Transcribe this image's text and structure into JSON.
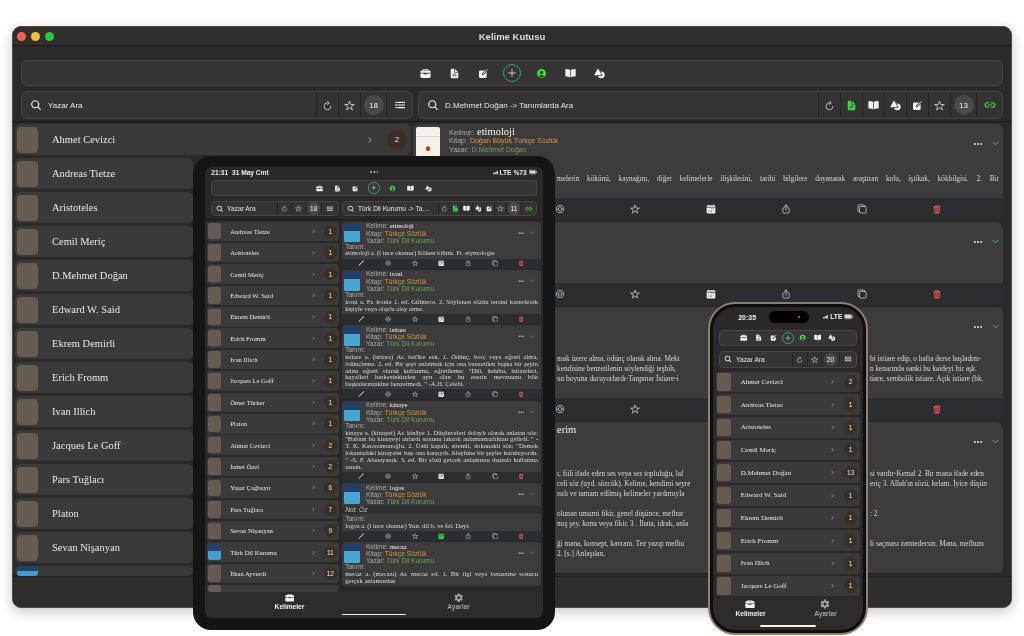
{
  "window": {
    "title": "Kelime Kutusu",
    "toolbar": [
      {
        "kind": "briefcase",
        "selected": false
      },
      {
        "kind": "document",
        "selected": false
      },
      {
        "kind": "edit",
        "selected": false
      },
      {
        "kind": "add",
        "selected": false
      },
      {
        "kind": "person",
        "selected": true
      },
      {
        "kind": "book",
        "selected": false
      },
      {
        "kind": "shapes",
        "selected": false
      }
    ],
    "author_search": {
      "placeholder": "Yazar Ara",
      "tools": [
        {
          "kind": "refresh",
          "on": false
        },
        {
          "kind": "star",
          "on": false
        }
      ],
      "count": "18",
      "trailing": [
        {
          "kind": "list",
          "on": false
        }
      ]
    },
    "word_search": {
      "placeholder": "D.Mehmet Doğan -> Tanımlarda Ara",
      "tools": [
        {
          "kind": "refresh",
          "on": false
        },
        {
          "kind": "document",
          "on": true
        },
        {
          "kind": "book",
          "on": false
        },
        {
          "kind": "shapes",
          "on": false
        },
        {
          "kind": "edit",
          "on": false
        },
        {
          "kind": "star",
          "on": false
        }
      ],
      "count": "13",
      "trailing": [
        {
          "kind": "link",
          "on": true
        }
      ]
    },
    "authors": [
      {
        "kind": "person",
        "name": "Ahmet Cevizci",
        "count": "2"
      },
      {
        "kind": "person",
        "name": "Andreas Tietze"
      },
      {
        "kind": "person",
        "name": "Aristoteles"
      },
      {
        "kind": "person",
        "name": "Cemil Meriç"
      },
      {
        "kind": "person",
        "name": "D.Mehmet Doğan"
      },
      {
        "kind": "person",
        "name": "Edward W. Said"
      },
      {
        "kind": "person",
        "name": "Ekrem Demirli"
      },
      {
        "kind": "person",
        "name": "Erich Fromm"
      },
      {
        "kind": "person",
        "name": "Ivan Illich"
      },
      {
        "kind": "person",
        "name": "Jacques Le Goff"
      },
      {
        "kind": "person",
        "name": "Pars Tuğlacı"
      },
      {
        "kind": "person",
        "name": "Platon"
      },
      {
        "kind": "person",
        "name": "Sevan Nişanyan"
      },
      {
        "kind": "book"
      }
    ],
    "words": [
      {
        "word_label": "Kelime:",
        "word": "etimoloji",
        "book_label": "Kitap:",
        "book": "Doğan Büyük Türkçe Sözlük",
        "author_label": "Yazar:",
        "author": "D.Mehmet Doğan",
        "paragraphs": [
          [
            {
              "start": "melerin kökünü, kaynağını, diğer kelimelerle ilişkilerini, tarihi bilgilere dayanarak araştıran kolu, iştikak, kökbilgisi. 2. Bir"
            }
          ]
        ],
        "reminder": false
      },
      {
        "reminder": false
      },
      {
        "paragraphs": [
          [
            {
              "start": "mak üzere alma, ödünç olarak alma. Mekt",
              "end": "bi istiare edip, o hafta derse başladım-"
            },
            {
              "start": "kendisine benzetilenin söylendiği teşbih,",
              "end": "n kenarında sanki bu kaideyi bir aşk"
            },
            {
              "start": "un boyuna duruyorlardı-Tanpınar İstiare-i",
              "end": "tiare, sembolik istiare. Açık istiare (bk."
            }
          ]
        ]
      },
      {
        "word": "erim",
        "paragraphs": [
          [
            {
              "start": "ı, fiili ifade eden ses veya ses topluluğu, laf",
              "end": "si vardır-Kemal 2. Bir mana ifade eden"
            },
            {
              "start": "celi söz (uyd. sözcük). Kelime, kendimi seyre",
              "end": "eriç 3. Allah'ın sözü, kelam. İyice düşün"
            },
            {
              "start": "ısılı ve tamam edilmiş kelimeler yardımıyla"
            }
          ],
          [
            {
              "start": "olunan umumi fikir, genel düşünce, mefhur",
              "end": ": 2."
            },
            {
              "start": "mış şey, konu veya fikir. 3 . İhata, idrak, anla"
            }
          ],
          [
            {
              "start": "ği mana, konsept, kavram. Tez yazıp mefhu",
              "end": "li saçması zannedersin. Mana, mefhum"
            },
            {
              "start": "2. [s.] Anlaşılan,"
            }
          ]
        ]
      }
    ]
  },
  "tablet": {
    "status": {
      "time": "21:31",
      "date": "31 May Cmt",
      "network": "LTE",
      "battery": "%73"
    },
    "toolbar": [
      {
        "kind": "briefcase",
        "selected": false
      },
      {
        "kind": "document",
        "selected": false
      },
      {
        "kind": "edit",
        "selected": false
      },
      {
        "kind": "add",
        "selected": false
      },
      {
        "kind": "person",
        "selected": true
      },
      {
        "kind": "book",
        "selected": false
      },
      {
        "kind": "shapes",
        "selected": false
      }
    ],
    "author_search": {
      "placeholder": "Yazar Ara",
      "tools": [
        {
          "kind": "refresh",
          "on": false
        },
        {
          "kind": "star",
          "on": false
        }
      ],
      "count": "18",
      "trailing": [
        {
          "kind": "list",
          "on": false
        }
      ]
    },
    "word_search": {
      "placeholder": "Türk Dil Kurumu -> Ta…",
      "tools": [
        {
          "kind": "refresh",
          "on": false
        },
        {
          "kind": "document",
          "on": true
        },
        {
          "kind": "book",
          "on": false
        },
        {
          "kind": "shapes",
          "on": false
        },
        {
          "kind": "edit",
          "on": false
        },
        {
          "kind": "star",
          "on": false
        }
      ],
      "count": "11",
      "trailing": [
        {
          "kind": "link",
          "on": true
        }
      ]
    },
    "authors": [
      {
        "kind": "person",
        "name": "Andreas Tietze",
        "count": "1"
      },
      {
        "kind": "person",
        "name": "Aristoteles",
        "count": "1"
      },
      {
        "kind": "person",
        "name": "Cemil Meriç",
        "count": "1"
      },
      {
        "kind": "person",
        "name": "Edward W. Said",
        "count": "1"
      },
      {
        "kind": "person",
        "name": "Ekrem Demirli",
        "count": "1"
      },
      {
        "kind": "person",
        "name": "Erich Fromm",
        "count": "1"
      },
      {
        "kind": "person",
        "name": "Ivan Illich",
        "count": "1"
      },
      {
        "kind": "person",
        "name": "Jacques Le Goff",
        "count": "1"
      },
      {
        "kind": "person",
        "name": "Ömer Türker",
        "count": "1"
      },
      {
        "kind": "person",
        "name": "Platon",
        "count": "1"
      },
      {
        "kind": "person",
        "name": "Ahmet Cevizci",
        "count": "2"
      },
      {
        "kind": "person",
        "name": "İsmet Özel",
        "count": "2"
      },
      {
        "kind": "person",
        "name": "Yaşar Çağbayır",
        "count": "6"
      },
      {
        "kind": "person",
        "name": "Pars Tuğlacı",
        "count": "7"
      },
      {
        "kind": "person",
        "name": "Sevan Nişanyan",
        "count": "9"
      },
      {
        "kind": "book",
        "name": "Türk Dil Kurumu",
        "count": "11"
      },
      {
        "kind": "person",
        "name": "İlhan Ayverdi",
        "count": "12"
      },
      {
        "kind": "person"
      }
    ],
    "words": [
      {
        "word_label": "Kelime:",
        "word": "etimoloji",
        "book_label": "Kitap:",
        "book": "Türkçe Sözlük",
        "author_label": "Yazar:",
        "author": "Türk Dil Kurumu",
        "definition_label": "Tanım:",
        "definition": "etimoloji a. (l ince okunur) Köken bilimi. Fr. etymologie",
        "reminder": false
      },
      {
        "word_label": "Kelime:",
        "word": "ironi",
        "book_label": "Kitap:",
        "book": "Türkçe Sözlük",
        "author_label": "Yazar:",
        "author": "Türk Dil Kurumu",
        "definition_label": "Tanım:",
        "definition": "ironi a. Fr. ironie 1. ed. Gülmece. 2. Söylenen sözün tersini kastederek kişiyle veya olayla alay etme.",
        "reminder": false
      },
      {
        "word_label": "Kelime:",
        "word": "istiare",
        "book_label": "Kitap:",
        "book": "Türkçe Sözlük",
        "author_label": "Yazar:",
        "author": "Türk Dil Kurumu",
        "definition_label": "Tanım:",
        "definition": "istiare a. (istiare) Ar. isti'āre esk. 1. Ödünç, borç veya eğreti alma, ödünçleme. 2. ed. Bir şeyi anlatmak için ona benzetilen başka bir şeyin adını eğreti olarak kullanma, eğretileme: \"Dili, üslubu, istiareleri, hayalleri herkesinkinden ayrı olan bu eserin mevzuunu bile başkalarınınkine benzetmedi. \" -A.H. Çelebi.",
        "reminder": false
      },
      {
        "word_label": "Kelime:",
        "word": "kinaye",
        "book_label": "Kitap:",
        "book": "Türkçe Sözlük",
        "author_label": "Yazar:",
        "author": "Türk Dil Kurumu",
        "definition_label": "Tanım:",
        "definition": "kinaye a. (kinayei) Ar. kināye 1. Düşünceleri dolaylı olarak anlatan söz: \"Babam bu kinayeyi anlardı sonunu lakırdı anlamamazlıktan gelirdi. \" -T. K. Karaosmanoğlu. 2. Üstü kapalı, sitemli, dokunaklı söz: \"Demek lokantadaki kinayeler hep ona karşıydı. Aleyhine bir şeyler kuruluyordu. \" -S. F. Abasıyanık. 3. ed. Bir sözü gerçek anlamının dışında kullanma sanatı.",
        "reminder": false
      },
      {
        "word_label": "Kelime:",
        "word": "logos",
        "book_label": "Kitap:",
        "book": "Türkçe Sözlük",
        "author_label": "Yazar:",
        "author": "Türk Dil Kurumu",
        "note": "Not: Öz",
        "definition_label": "Tanım:",
        "definition": "logos a. (l ince okunur) Yun. dil b. ve fel. Deyi.",
        "reminder": true
      },
      {
        "word_label": "Kelime:",
        "word": "mecaz",
        "book_label": "Kitap:",
        "book": "Türkçe Sözlük",
        "author_label": "Yazar:",
        "author": "Türk Dil Kurumu",
        "definition_label": "Tanım:",
        "definition": "mecaz a. (mecazı) Ar. mecaz ed. 1. Bir ilgi veya benzetme sonucu gerçek anlamından"
      }
    ],
    "tabs": [
      {
        "kind": "briefcase",
        "label": "Kelimeler",
        "selected": true
      },
      {
        "kind": "gear",
        "label": "Ayarlar",
        "selected": false
      }
    ]
  },
  "phone": {
    "status": {
      "time": "20:35",
      "network": "LTE"
    },
    "toolbar": [
      {
        "kind": "briefcase",
        "selected": false
      },
      {
        "kind": "document",
        "selected": false
      },
      {
        "kind": "edit",
        "selected": false
      },
      {
        "kind": "add",
        "selected": false
      },
      {
        "kind": "person",
        "selected": true
      },
      {
        "kind": "book",
        "selected": false
      },
      {
        "kind": "shapes",
        "selected": false
      }
    ],
    "author_search": {
      "placeholder": "Yazar Ara",
      "tools": [
        {
          "kind": "refresh",
          "on": false
        },
        {
          "kind": "star",
          "on": false
        }
      ],
      "count": "20",
      "trailing": [
        {
          "kind": "list",
          "on": false
        }
      ]
    },
    "authors": [
      {
        "kind": "person",
        "name": "Ahmet Cevizci",
        "count": "2"
      },
      {
        "kind": "person",
        "name": "Andreas Tietze",
        "count": "1"
      },
      {
        "kind": "person",
        "name": "Aristoteles",
        "count": "1"
      },
      {
        "kind": "person",
        "name": "Cemil Meriç",
        "count": "1"
      },
      {
        "kind": "person",
        "name": "D.Mehmet Doğan",
        "count": "13"
      },
      {
        "kind": "person",
        "name": "Edward W. Said",
        "count": "1"
      },
      {
        "kind": "person",
        "name": "Ekrem Demirli",
        "count": "1"
      },
      {
        "kind": "person",
        "name": "Erich Fromm",
        "count": "1"
      },
      {
        "kind": "person",
        "name": "Ivan Illich",
        "count": "1"
      },
      {
        "kind": "person",
        "name": "Jacques Le Goff",
        "count": "1"
      }
    ],
    "tabs": [
      {
        "kind": "briefcase",
        "label": "Kelimeler",
        "selected": true
      },
      {
        "kind": "gear",
        "label": "Ayarlar",
        "selected": false
      }
    ]
  }
}
